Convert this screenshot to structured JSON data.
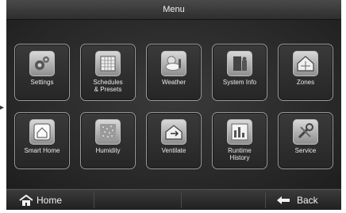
{
  "header": {
    "title": "Menu"
  },
  "tiles": [
    {
      "label": "Settings",
      "icon": "gears-icon"
    },
    {
      "label": "Schedules\n& Presets",
      "icon": "calendar-icon"
    },
    {
      "label": "Weather",
      "icon": "weather-icon"
    },
    {
      "label": "System Info",
      "icon": "system-info-icon"
    },
    {
      "label": "Zones",
      "icon": "zones-house-icon"
    },
    {
      "label": "Smart Home",
      "icon": "smart-home-icon"
    },
    {
      "label": "Humidity",
      "icon": "humidity-icon"
    },
    {
      "label": "Ventilate",
      "icon": "ventilate-icon"
    },
    {
      "label": "Runtime\nHistory",
      "icon": "bar-chart-icon"
    },
    {
      "label": "Service",
      "icon": "service-tools-icon"
    }
  ],
  "footer": {
    "home_label": "Home",
    "back_label": "Back"
  }
}
